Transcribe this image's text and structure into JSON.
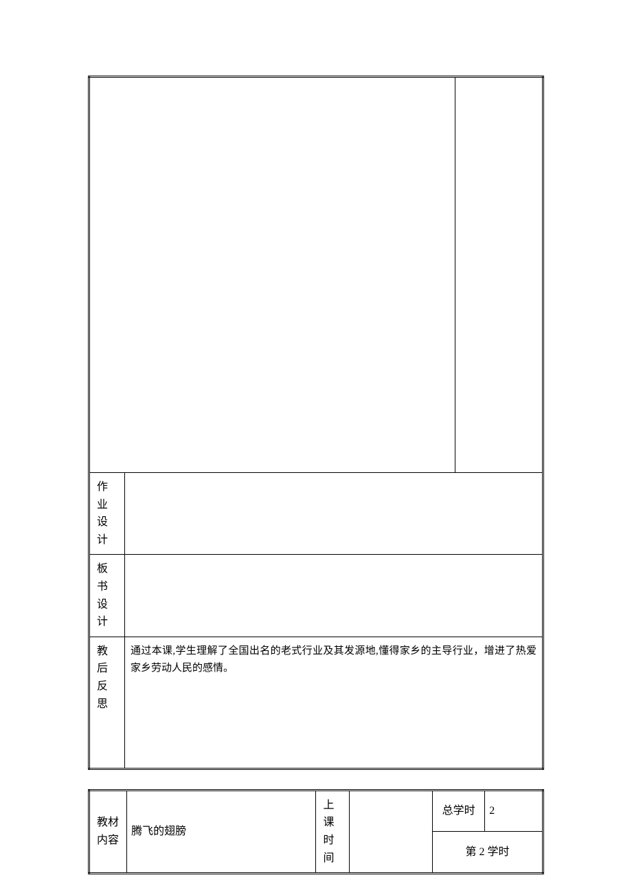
{
  "table1": {
    "homework_label": "作业设计",
    "board_label": "板书设计",
    "reflect_label": "教后反思",
    "reflect_text": "通过本课,学生理解了全国出名的老式行业及其发源地,懂得家乡的主导行业，增进了热爱家乡劳动人民的感情。"
  },
  "table2": {
    "material_label": "教材内容",
    "material_value": "腾飞的翅膀",
    "class_time_label": "上课时间",
    "total_hours_label": "总学时",
    "total_hours_value": "2",
    "period_label": "第 2 学时"
  }
}
